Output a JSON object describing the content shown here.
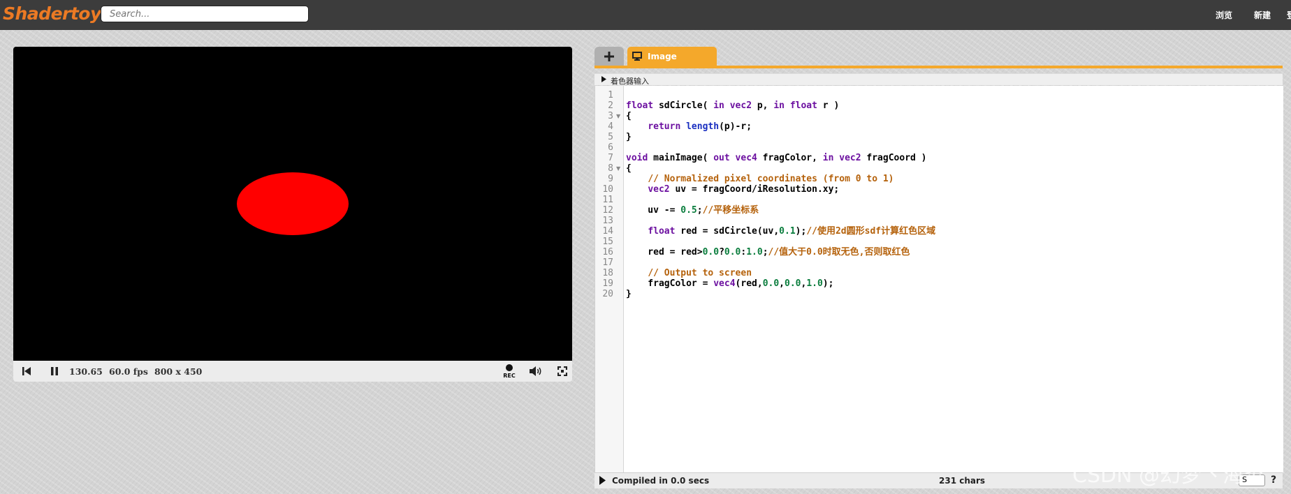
{
  "topbar": {
    "logo": "Shadertoy",
    "search_placeholder": "Search...",
    "nav_browse": "浏览",
    "nav_new": "新建",
    "nav_cut": "登"
  },
  "player": {
    "time": "130.65",
    "fps": "60.0 fps",
    "resolution": "800 x 450",
    "rec_label": "REC",
    "circle_color": "#ff0000"
  },
  "editor": {
    "tab_image": "Image",
    "shader_inputs_label": "着色器输入",
    "line_numbers": [
      "1",
      "2",
      "3",
      "4",
      "5",
      "6",
      "7",
      "8",
      "9",
      "10",
      "11",
      "12",
      "13",
      "14",
      "15",
      "16",
      "17",
      "18",
      "19",
      "20"
    ],
    "code_lines": [
      "",
      "float sdCircle( in vec2 p, in float r )",
      "{",
      "    return length(p)-r;",
      "}",
      "",
      "void mainImage( out vec4 fragColor, in vec2 fragCoord )",
      "{",
      "    // Normalized pixel coordinates (from 0 to 1)",
      "    vec2 uv = fragCoord/iResolution.xy;",
      "",
      "    uv -= 0.5;//平移坐标系",
      "",
      "    float red = sdCircle(uv,0.1);//使用2d圆形sdf计算红色区域",
      "",
      "    red = red>0.0?0.0:1.0;//值大于0.0时取无色,否则取红色",
      "",
      "    // Output to screen",
      "    fragColor = vec4(red,0.0,0.0,1.0);",
      "}"
    ],
    "compiled_status": "Compiled in 0.0 secs",
    "char_count": "231 chars",
    "font_size_value": "S",
    "help_label": "?"
  },
  "watermark": "CSDN @幻梦丶海炎",
  "colors": {
    "accent": "#f4a82b",
    "logo": "#ec7a24",
    "topbar": "#3c3c3c"
  }
}
